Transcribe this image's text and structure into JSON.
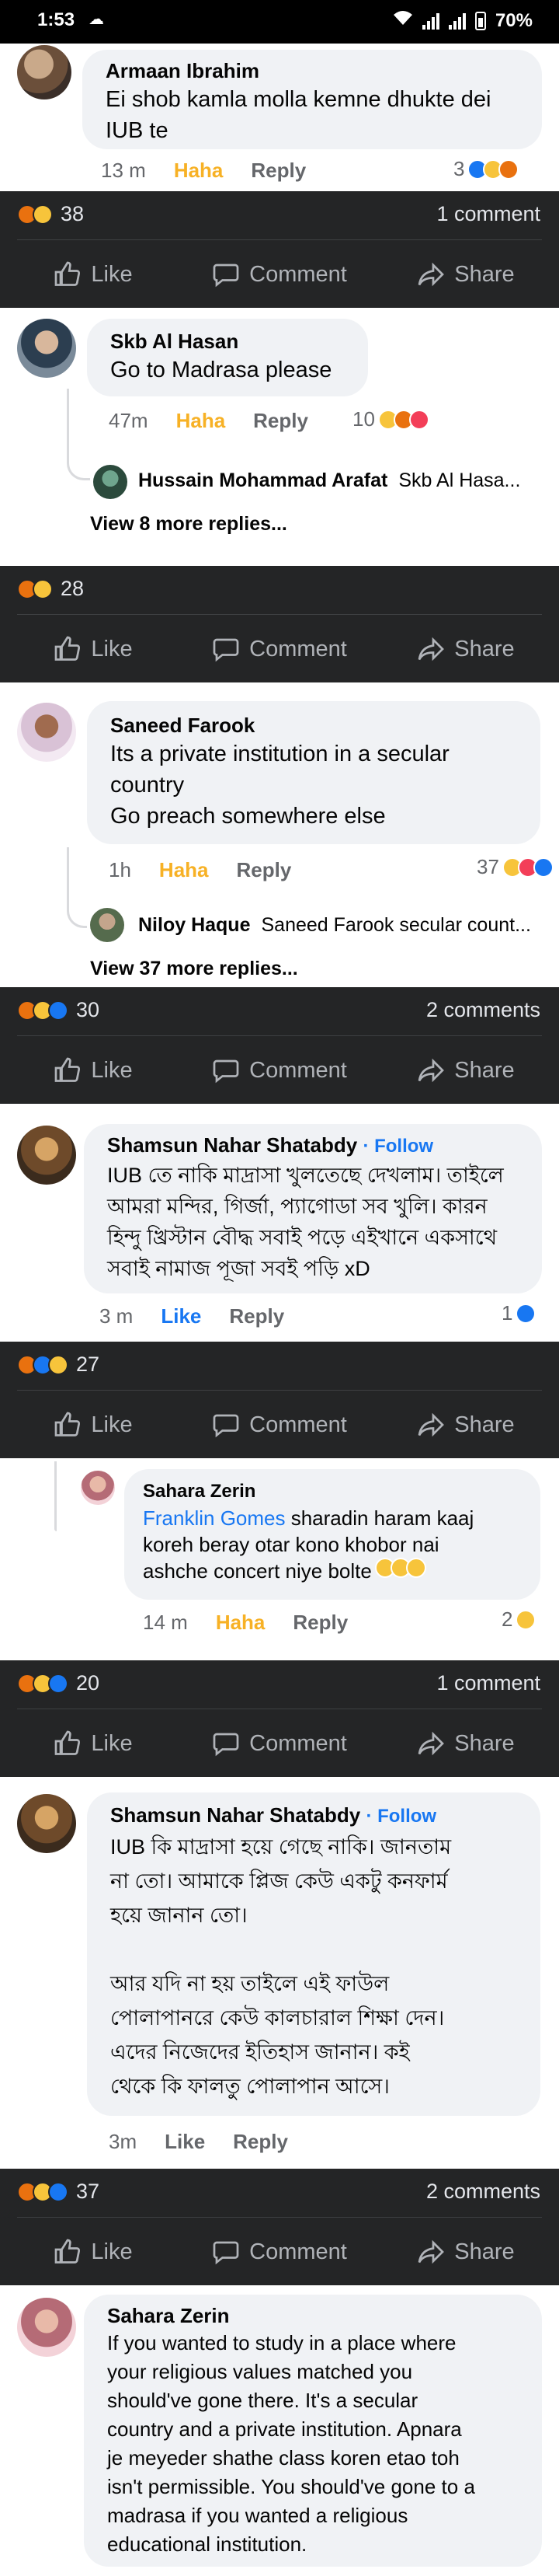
{
  "status_bar": {
    "time": "1:53",
    "battery": "70%"
  },
  "comments": [
    {
      "author": "Armaan Ibrahim",
      "text": "Ei shob kamla molla kemne dhukte dei\nIUB te",
      "time": "13 m",
      "haha": "Haha",
      "reply": "Reply",
      "reaction_count": "3"
    },
    {
      "author": "Skb Al Hasan",
      "text": "Go to Madrasa please",
      "time": "47m",
      "haha": "Haha",
      "reply": "Reply",
      "reaction_count": "10",
      "reply_preview": {
        "name": "Hussain Mohammad Arafat",
        "snippet": "Skb Al Hasa..."
      },
      "view_more": "View 8 more replies..."
    },
    {
      "author": "Saneed Farook",
      "text": "Its a private institution in a secular\ncountry\nGo preach somewhere else",
      "time": "1h",
      "haha": "Haha",
      "reply": "Reply",
      "reaction_count": "37",
      "reply_preview": {
        "name": "Niloy Haque",
        "snippet": "Saneed Farook secular count..."
      },
      "view_more": "View 37 more replies..."
    },
    {
      "author": "Shamsun Nahar Shatabdy",
      "follow": "· Follow",
      "text": "IUB তে নাকি মাদ্রাসা খুলতেছে দেখলাম। তাইলে\nআমরা মন্দির, গির্জা, প্যাগোডা সব খুলি। কারন\nহিন্দু খ্রিস্টান বৌদ্ধ সবাই পড়ে এইখানে একসাথে\nসবাই নামাজ পূজা সবই পড়ি xD",
      "time": "3 m",
      "like": "Like",
      "reply": "Reply",
      "reaction_count": "1"
    },
    {
      "author": "Sahara Zerin",
      "mention": "Franklin Gomes",
      "text": " sharadin haram kaaj\nkoreh beray otar kono khobor nai\nashche concert niye bolte",
      "time": "14 m",
      "haha": "Haha",
      "reply": "Reply",
      "reaction_count": "2"
    },
    {
      "author": "Shamsun Nahar Shatabdy",
      "follow": "· Follow",
      "text": "IUB কি মাদ্রাসা হয়ে গেছে নাকি। জানতাম\nনা তো। আমাকে প্লিজ কেউ একটু কনফার্ম\nহয়ে জানান তো।\n\nআর যদি না হয় তাইলে এই ফাউল\nপোলাপানরে কেউ কালচারাল শিক্ষা দেন।\nএদের নিজেদের ইতিহাস জানান। কই\nথেকে কি ফালতু পোলাপান আসে।",
      "time": "3m",
      "like": "Like",
      "reply": "Reply"
    },
    {
      "author": "Sahara Zerin",
      "text": "If you wanted to study in a place where\nyour religious values matched you\nshould've gone there. It's a secular\ncountry and a private institution. Apnara\nje meyeder shathe class koren etao toh\nisn't permissible. You should've gone to a\nmadrasa if you wanted a religious\neducational institution."
    }
  ],
  "bars": [
    {
      "count": "38",
      "comments": "1 comment"
    },
    {
      "count": "28",
      "comments": ""
    },
    {
      "count": "30",
      "comments": "2 comments"
    },
    {
      "count": "27",
      "comments": ""
    },
    {
      "count": "20",
      "comments": "1 comment"
    },
    {
      "count": "37",
      "comments": "2 comments"
    }
  ],
  "actions": {
    "like": "Like",
    "comment": "Comment",
    "share": "Share"
  }
}
